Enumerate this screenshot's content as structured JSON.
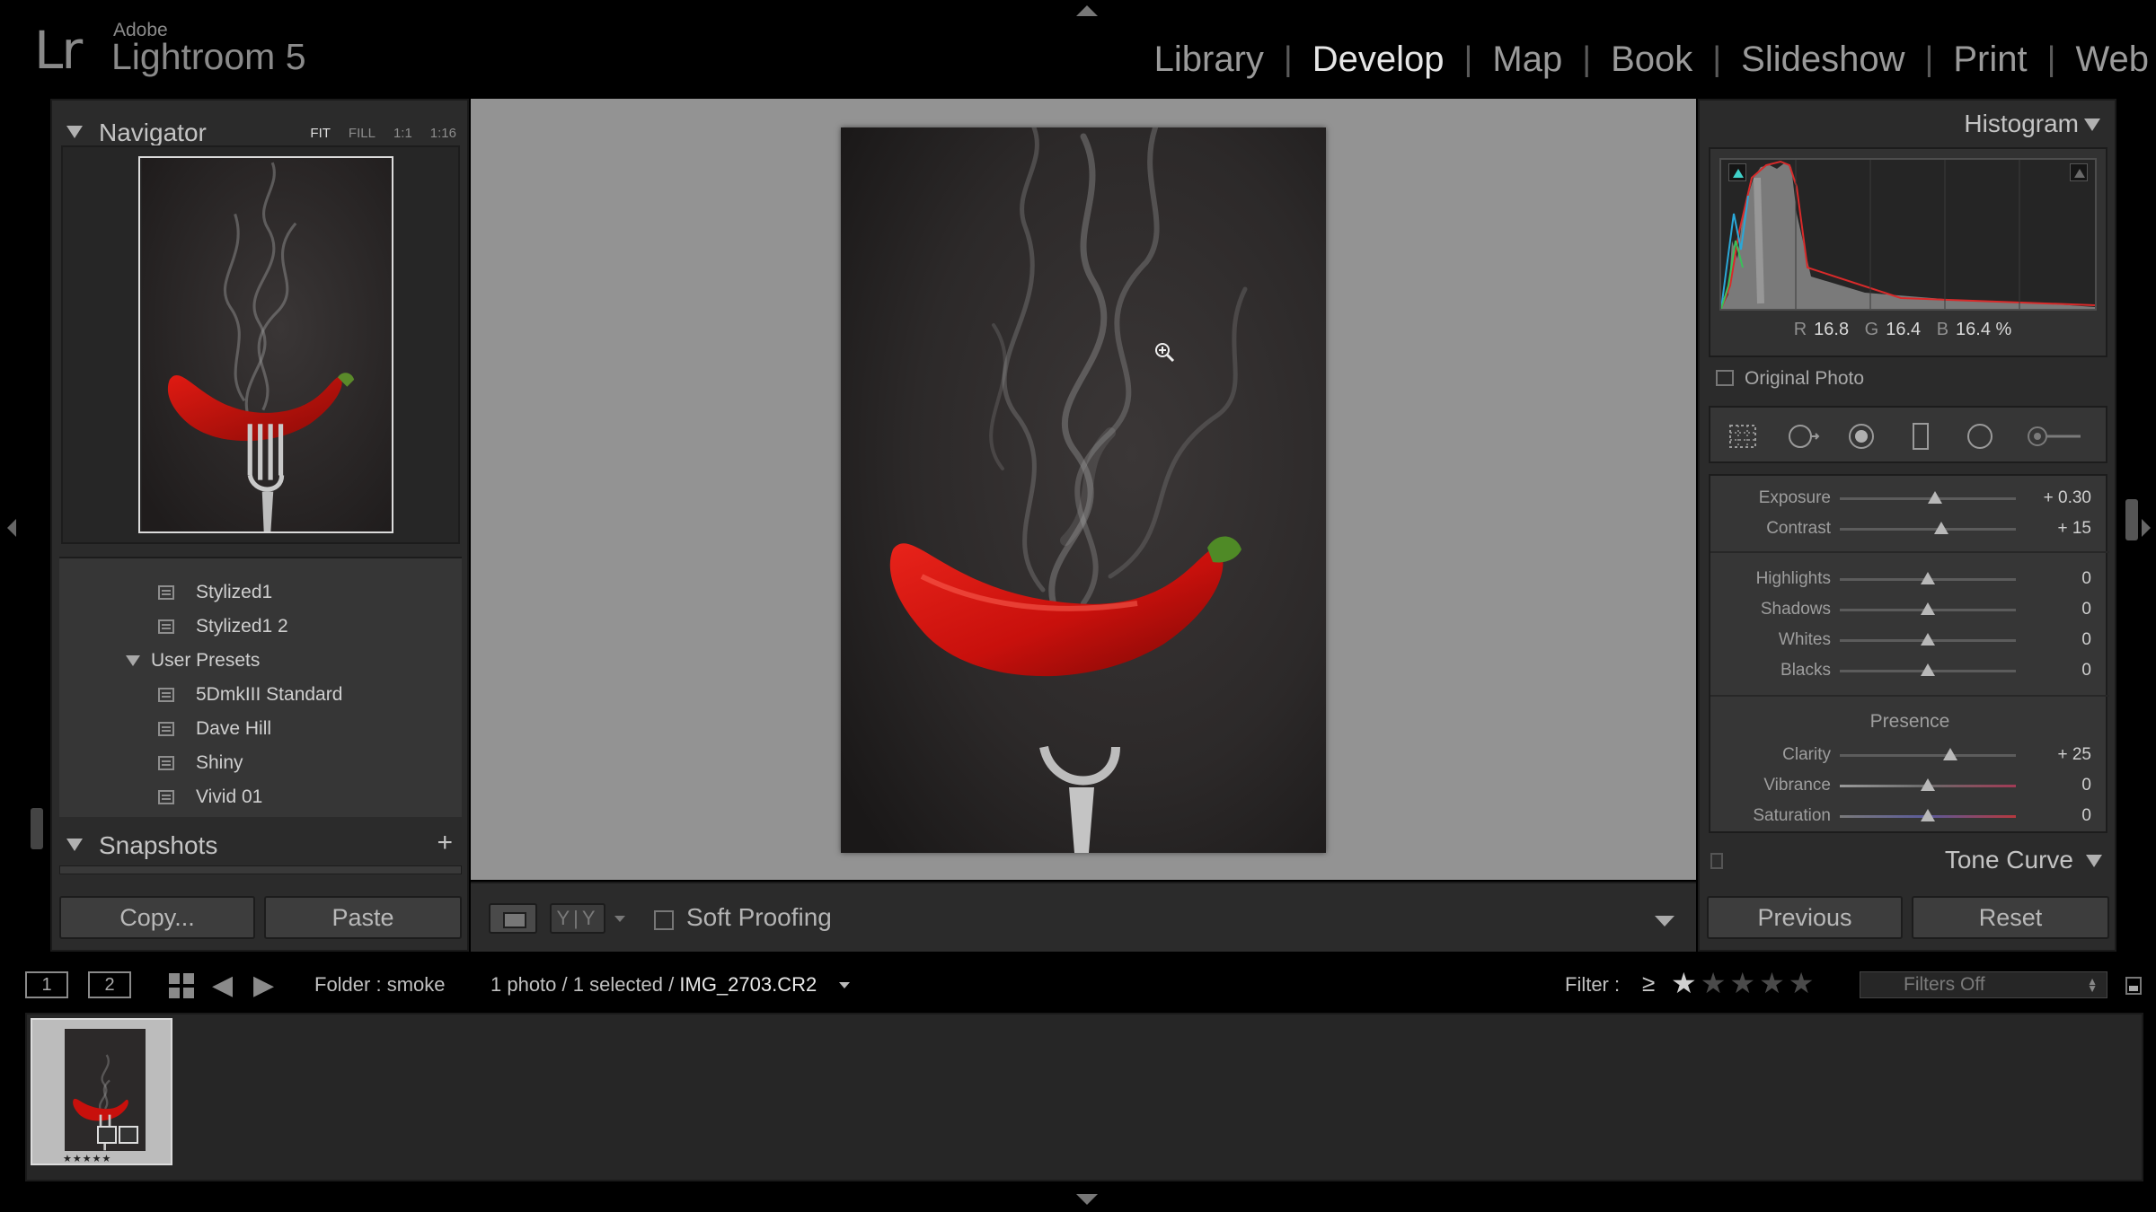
{
  "app": {
    "logo": "Lr",
    "vendor": "Adobe",
    "product": "Lightroom 5"
  },
  "modules": [
    {
      "label": "Library",
      "active": false
    },
    {
      "label": "Develop",
      "active": true
    },
    {
      "label": "Map",
      "active": false
    },
    {
      "label": "Book",
      "active": false
    },
    {
      "label": "Slideshow",
      "active": false
    },
    {
      "label": "Print",
      "active": false
    },
    {
      "label": "Web",
      "active": false
    }
  ],
  "navigator": {
    "title": "Navigator",
    "zoom_options": [
      "FIT",
      "FILL",
      "1:1",
      "1:16"
    ],
    "active_zoom": "FIT"
  },
  "presets": {
    "items": [
      {
        "label": "Stylized1"
      },
      {
        "label": "Stylized1 2"
      }
    ],
    "user_folder": "User Presets",
    "user_items": [
      {
        "label": "5DmkIII Standard"
      },
      {
        "label": "Dave Hill"
      },
      {
        "label": "Shiny"
      },
      {
        "label": "Vivid 01"
      }
    ]
  },
  "snapshots": {
    "title": "Snapshots",
    "add": "+"
  },
  "left_buttons": {
    "copy": "Copy...",
    "paste": "Paste"
  },
  "toolbar": {
    "soft_proofing": "Soft Proofing",
    "yy": "Y|Y"
  },
  "histogram": {
    "title": "Histogram",
    "r_label": "R",
    "r": "16.8",
    "g_label": "G",
    "g": "16.4",
    "b_label": "B",
    "b": "16.4 %",
    "original_photo": "Original Photo"
  },
  "tools": [
    "crop-overlay-icon",
    "spot-removal-icon",
    "red-eye-icon",
    "graduated-filter-icon",
    "radial-filter-icon",
    "adjustment-brush-icon"
  ],
  "basic": {
    "tone": [
      {
        "label": "Exposure",
        "value": "+ 0.30",
        "pos": 0.54
      },
      {
        "label": "Contrast",
        "value": "+ 15",
        "pos": 0.575
      }
    ],
    "tone2": [
      {
        "label": "Highlights",
        "value": "0",
        "pos": 0.5
      },
      {
        "label": "Shadows",
        "value": "0",
        "pos": 0.5
      },
      {
        "label": "Whites",
        "value": "0",
        "pos": 0.5
      },
      {
        "label": "Blacks",
        "value": "0",
        "pos": 0.5
      }
    ],
    "presence_title": "Presence",
    "presence": [
      {
        "label": "Clarity",
        "value": "+ 25",
        "pos": 0.625
      },
      {
        "label": "Vibrance",
        "value": "0",
        "pos": 0.5
      },
      {
        "label": "Saturation",
        "value": "0",
        "pos": 0.5
      }
    ]
  },
  "tone_curve": {
    "title": "Tone Curve"
  },
  "right_buttons": {
    "previous": "Previous",
    "reset": "Reset"
  },
  "filmbar": {
    "screen1": "1",
    "screen2": "2",
    "folder": "Folder : smoke",
    "selection": "1 photo / 1 selected /",
    "filename": "IMG_2703.CR2",
    "filter_label": "Filter :",
    "filter_op": "≥",
    "filter_stars": 1,
    "filters_preset": "Filters Off"
  },
  "filmstrip": {
    "rating_stars": 5,
    "stars_text": "★★★★★"
  },
  "colors": {
    "accent_red": "#c8100c",
    "panel_bg": "#2b2b2b",
    "canvas_bg": "#939393"
  }
}
